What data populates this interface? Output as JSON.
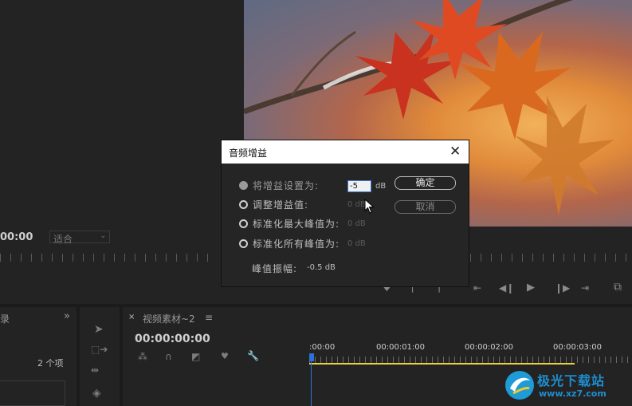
{
  "monitor": {
    "timecode": "00:00",
    "fit_select": "适合"
  },
  "project_panel": {
    "tab_label": "录",
    "expand_glyph": "»",
    "item_count": "2 个项"
  },
  "timeline": {
    "close_glyph": "×",
    "tab_label": "视频素材~2",
    "menu_glyph": "≡",
    "timecode": "00:00:00:00",
    "ticks": [
      ":00:00",
      "00:00:01:00",
      "00:00:02:00",
      "00:00:03:00"
    ]
  },
  "dialog": {
    "title": "音频增益",
    "close_glyph": "✕",
    "options": [
      {
        "label": "将增益设置为:",
        "value": "-5",
        "unit": "dB",
        "selected": true
      },
      {
        "label": "调整增益值:",
        "value": "0 dB",
        "selected": false
      },
      {
        "label": "标准化最大峰值为:",
        "value": "0 dB",
        "selected": false
      },
      {
        "label": "标准化所有峰值为:",
        "value": "0 dB",
        "selected": false
      }
    ],
    "peak_label": "峰值振幅:",
    "peak_value": "-0.5 dB",
    "ok_label": "确定",
    "cancel_label": "取消"
  },
  "watermark": {
    "name": "极光下载站",
    "url": "www.xz7.com"
  },
  "colors": {
    "accent_blue": "#3d7be0",
    "playhead_blue": "#2f6fdc",
    "work_area_yellow": "#e6d23a"
  }
}
